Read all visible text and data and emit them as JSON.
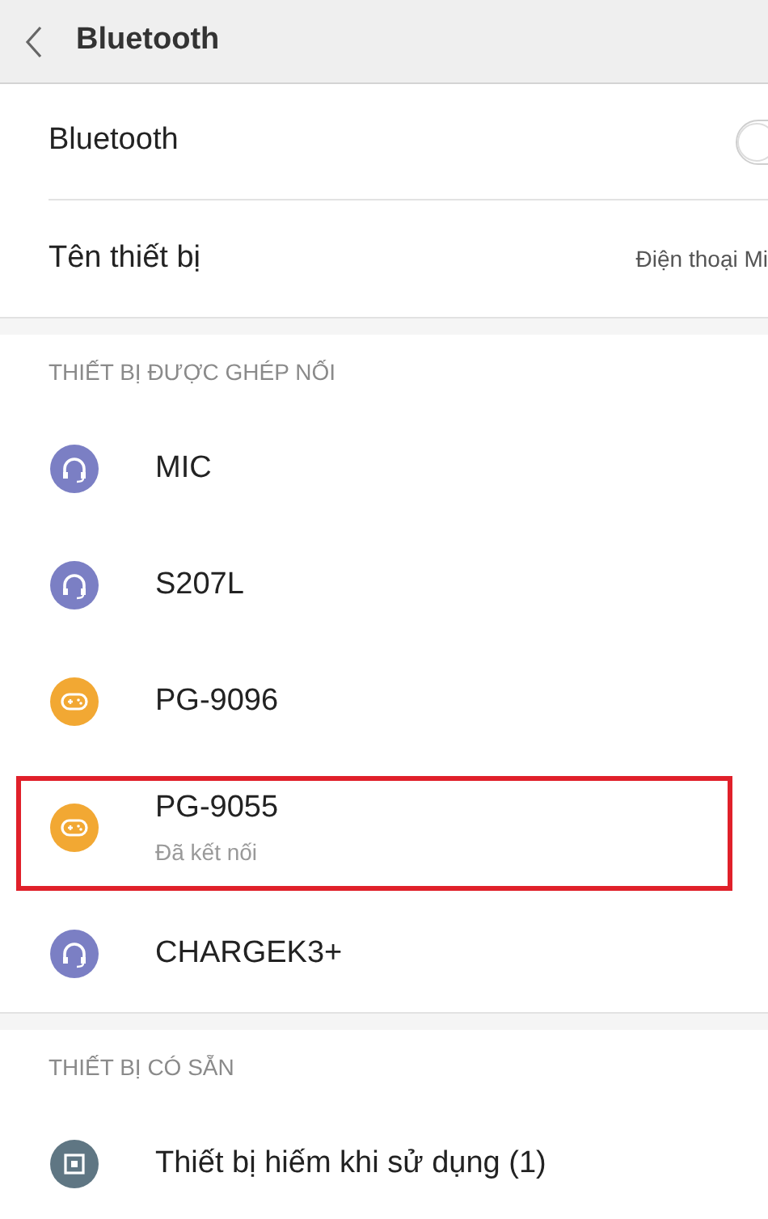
{
  "header": {
    "title": "Bluetooth"
  },
  "settings": [
    {
      "kind": "switch",
      "label": "Bluetooth",
      "on": false
    },
    {
      "kind": "value",
      "label": "Tên thiết bị",
      "value": "Điện thoại Mi"
    }
  ],
  "sections": [
    {
      "title": "THIẾT BỊ ĐƯỢC GHÉP NỐI",
      "devices": [
        {
          "kind": "headset",
          "name": "MIC",
          "highlighted": false
        },
        {
          "kind": "headset",
          "name": "S207L",
          "highlighted": false
        },
        {
          "kind": "gamepad",
          "name": "PG-9096",
          "highlighted": false
        },
        {
          "kind": "gamepad",
          "name": "PG-9055",
          "status": "Đã kết nối",
          "highlighted": true
        },
        {
          "kind": "headset",
          "name": "CHARGEK3+",
          "highlighted": false
        }
      ]
    },
    {
      "title": "THIẾT BỊ CÓ SẴN",
      "devices": [
        {
          "kind": "other",
          "name": "Thiết bị hiếm khi sử dụng (1)",
          "highlighted": false
        }
      ]
    }
  ]
}
